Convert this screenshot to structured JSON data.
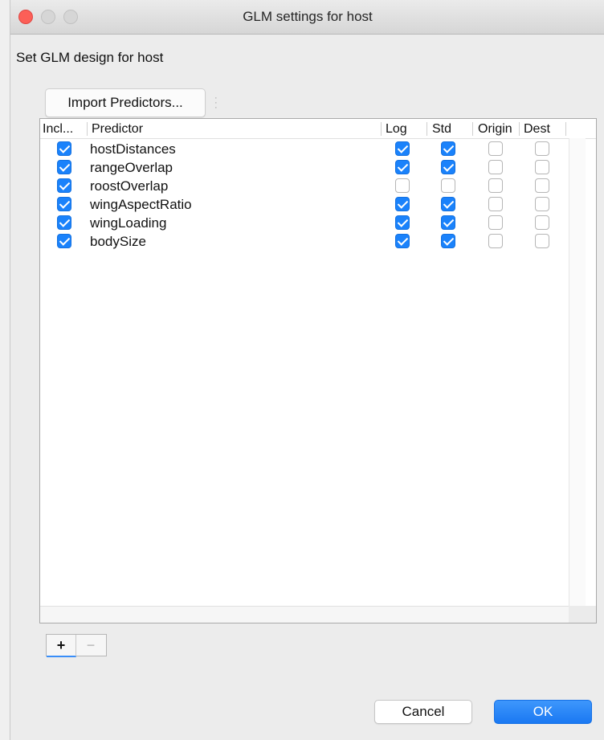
{
  "window": {
    "title": "GLM settings for host"
  },
  "heading": "Set GLM design for host",
  "toolbar": {
    "import_label": "Import Predictors..."
  },
  "table": {
    "columns": {
      "include": "Incl...",
      "predictor": "Predictor",
      "log": "Log",
      "std": "Std",
      "origin": "Origin",
      "dest": "Dest"
    },
    "rows": [
      {
        "include": true,
        "predictor": "hostDistances",
        "log": true,
        "std": true,
        "origin": false,
        "dest": false
      },
      {
        "include": true,
        "predictor": "rangeOverlap",
        "log": true,
        "std": true,
        "origin": false,
        "dest": false
      },
      {
        "include": true,
        "predictor": "roostOverlap",
        "log": false,
        "std": false,
        "origin": false,
        "dest": false
      },
      {
        "include": true,
        "predictor": "wingAspectRatio",
        "log": true,
        "std": true,
        "origin": false,
        "dest": false
      },
      {
        "include": true,
        "predictor": "wingLoading",
        "log": true,
        "std": true,
        "origin": false,
        "dest": false
      },
      {
        "include": true,
        "predictor": "bodySize",
        "log": true,
        "std": true,
        "origin": false,
        "dest": false
      }
    ]
  },
  "list_controls": {
    "add_label": "+",
    "remove_label": "−"
  },
  "buttons": {
    "cancel_label": "Cancel",
    "ok_label": "OK"
  },
  "colors": {
    "checked": "#1a82fb",
    "close": "#fc5f57",
    "ok": "#1a78f2"
  }
}
